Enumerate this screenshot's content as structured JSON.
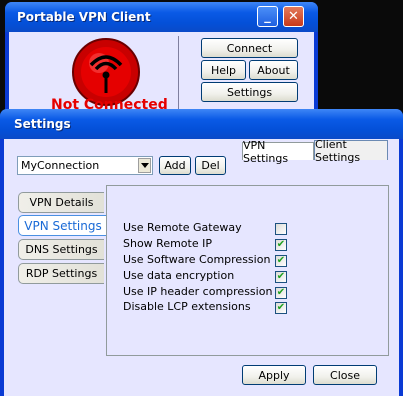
{
  "client_window": {
    "title": "Portable VPN Client",
    "status": "Not Connected",
    "buttons": {
      "connect": "Connect",
      "help": "Help",
      "about": "About",
      "settings": "Settings"
    },
    "title_buttons": {
      "minimize": "_",
      "close": "✕"
    }
  },
  "settings_window": {
    "title": "Settings",
    "tabs": [
      {
        "label": "VPN Settings"
      },
      {
        "label": "Client Settings"
      }
    ],
    "connection_select": {
      "value": "MyConnection"
    },
    "add_label": "Add",
    "del_label": "Del",
    "side_tabs": [
      {
        "label": "VPN Details"
      },
      {
        "label": "VPN Settings"
      },
      {
        "label": "DNS Settings"
      },
      {
        "label": "RDP Settings"
      }
    ],
    "options": [
      {
        "label": "Use Remote Gateway",
        "checked": false
      },
      {
        "label": "Show Remote IP",
        "checked": true
      },
      {
        "label": "Use Software Compression",
        "checked": true
      },
      {
        "label": "Use data encryption",
        "checked": true
      },
      {
        "label": "Use IP header compression",
        "checked": true
      },
      {
        "label": "Disable LCP extensions",
        "checked": true
      }
    ],
    "apply_label": "Apply",
    "close_label": "Close"
  },
  "colors": {
    "status_red": "#e50000",
    "accent_blue": "#0450d8",
    "panel_lavender": "#e6e6ff"
  }
}
